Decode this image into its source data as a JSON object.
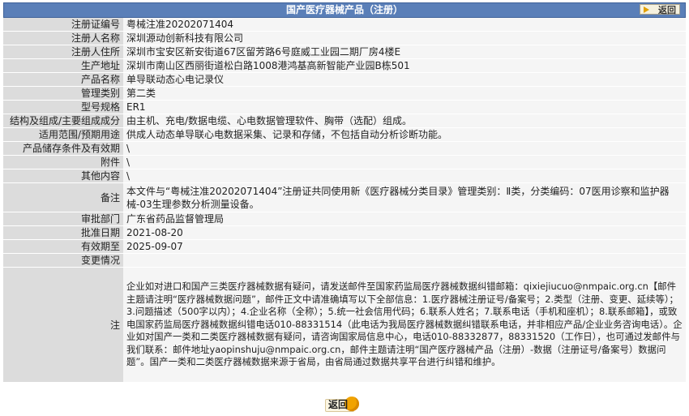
{
  "header": {
    "title": "国产医疗器械产品（注册）",
    "back_label": "返回"
  },
  "rows": [
    {
      "label": "注册证编号",
      "value": "粤械注准20202071404"
    },
    {
      "label": "注册人名称",
      "value": "深圳源动创新科技有限公司"
    },
    {
      "label": "注册人住所",
      "value": "深圳市宝安区新安街道67区留芳路6号庭威工业园二期厂房4楼E"
    },
    {
      "label": "生产地址",
      "value": "深圳市南山区西丽街道松白路1008港鸿基高新智能产业园B栋501"
    },
    {
      "label": "产品名称",
      "value": "单导联动态心电记录仪"
    },
    {
      "label": "管理类别",
      "value": "第二类"
    },
    {
      "label": "型号规格",
      "value": "ER1"
    },
    {
      "label": "结构及组成/主要组成成分",
      "value": "由主机、充电/数据电缆、心电数据管理软件、胸带（选配）组成。"
    },
    {
      "label": "适用范围/预期用途",
      "value": "供成人动态单导联心电数据采集、记录和存储，不包括自动分析诊断功能。"
    },
    {
      "label": "产品储存条件及有效期",
      "value": "\\"
    },
    {
      "label": "附件",
      "value": "\\"
    },
    {
      "label": "其他内容",
      "value": "\\"
    },
    {
      "label": "备注",
      "value": "本文件与“粤械注准20202071404”注册证共同使用新《医疗器械分类目录》管理类别：Ⅱ类，分类编码：07医用诊察和监护器械-03生理参数分析测量设备。"
    },
    {
      "label": "审批部门",
      "value": "广东省药品监督管理局"
    },
    {
      "label": "批准日期",
      "value": "2021-08-20"
    },
    {
      "label": "有效期至",
      "value": "2025-09-07"
    },
    {
      "label": "变更情况",
      "value": ""
    },
    {
      "label": "注",
      "value": "企业如对进口和国产三类医疗器械数据有疑问，请发送邮件至国家药监局医疗器械数据纠错邮箱：qixiejiucuo@nmpaic.org.cn【邮件主题请注明“医疗器械数据问题”，邮件正文中请准确填写以下全部信息：1.医疗器械注册证号/备案号；2.类型（注册、变更、延续等）；3.问题描述（500字以内）；4.企业名称（全称）；5.统一社会信用代码；6.联系人姓名；7.联系电话（手机和座机）；8.联系邮箱】，或致电国家药监局医疗器械数据纠错电话010-88331514（此电话为我局医疗器械数据纠错联系电话，并非相应产品/企业业务咨询电话）。企业如对国产一类和二类医疗器械数据有疑问，请咨询国家局信息中心，电话010-88332877，88331520（工作日），也可通过发邮件与我们联系：邮件地址yaopinshuju@nmpaic.org.cn，邮件主题请注明“国产医疗器械产品（注册）-数据（注册证号/备案号）数据问题”。国产一类和二类医疗器械数据来源于省局，由省局通过数据共享平台进行纠错和维护。"
    }
  ],
  "footer": {
    "back_label": "返回"
  }
}
